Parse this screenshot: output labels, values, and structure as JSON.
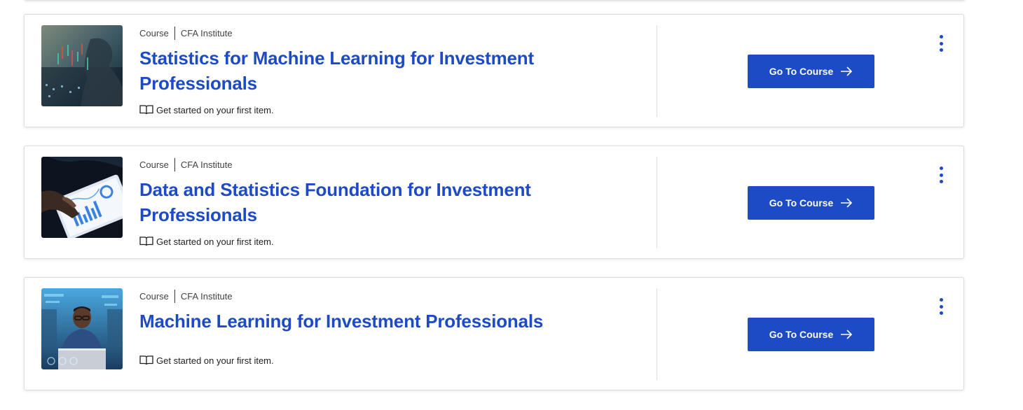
{
  "courses": [
    {
      "type": "Course",
      "provider": "CFA Institute",
      "title": "Statistics for Machine Learning for Investment Professionals",
      "status": "Get started on your first item.",
      "cta": "Go To Course",
      "thumb_icon": "data-silhouette-image"
    },
    {
      "type": "Course",
      "provider": "CFA Institute",
      "title": "Data and Statistics Foundation for Investment Professionals",
      "status": "Get started on your first item.",
      "cta": "Go To Course",
      "thumb_icon": "tablet-chart-image"
    },
    {
      "type": "Course",
      "provider": "CFA Institute",
      "title": "Machine Learning for Investment Professionals",
      "status": "Get started on your first item.",
      "cta": "Go To Course",
      "thumb_icon": "person-laptop-image"
    }
  ],
  "colors": {
    "accent": "#1c4bc5",
    "text": "#1f1f1f",
    "border": "#dcdcdc"
  }
}
